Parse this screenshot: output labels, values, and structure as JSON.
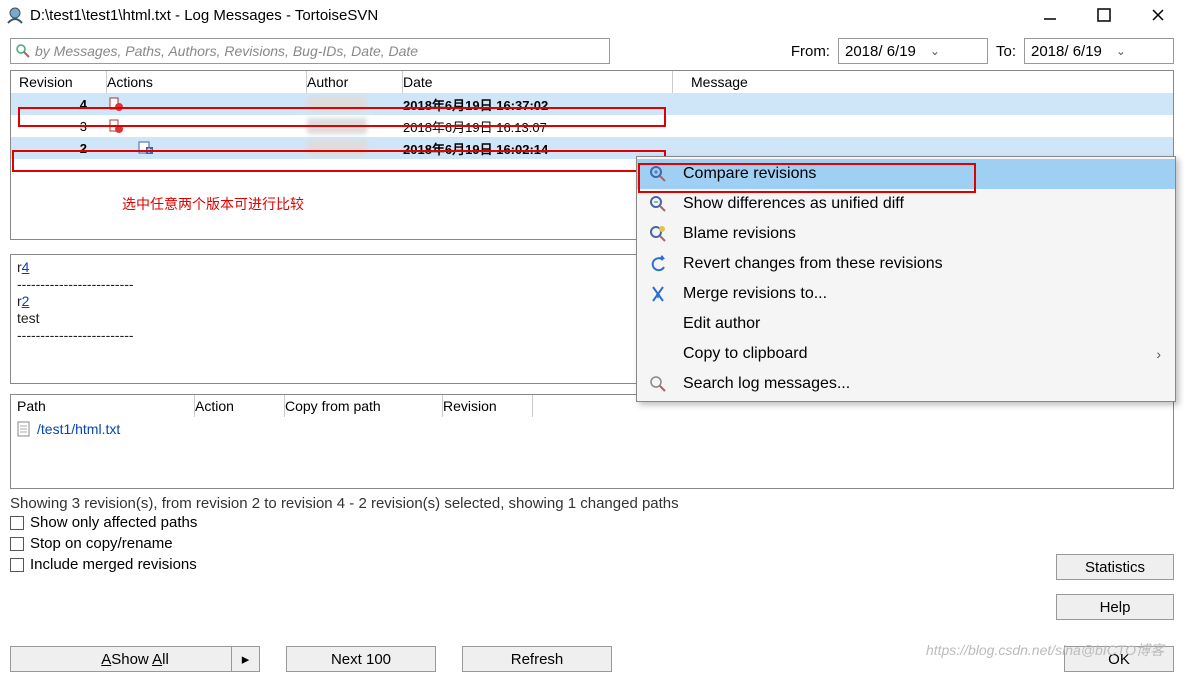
{
  "title": "D:\\test1\\test1\\html.txt - Log Messages - TortoiseSVN",
  "search_placeholder": "by Messages, Paths, Authors, Revisions, Bug-IDs, Date, Date",
  "from_label": "From:",
  "to_label": "To:",
  "from_date": "2018/ 6/19",
  "to_date": "2018/ 6/19",
  "cols": {
    "revision": "Revision",
    "actions": "Actions",
    "author": "Author",
    "date": "Date",
    "message": "Message"
  },
  "rows": [
    {
      "rev": "4",
      "date": "2018年6月19日 16:37:02",
      "selected": true
    },
    {
      "rev": "3",
      "date": "2018年6月19日 16:13:07",
      "selected": false
    },
    {
      "rev": "2",
      "date": "2018年6月19日 16:02:14",
      "selected": true
    }
  ],
  "red_annotation": "选中任意两个版本可进行比较",
  "detail": {
    "r4": "r",
    "r4link": "4",
    "dash": "-------------------------",
    "r2": "r",
    "r2link": "2",
    "msg": "test"
  },
  "pcols": {
    "path": "Path",
    "action": "Action",
    "copy": "Copy from path",
    "rev": "Revision"
  },
  "path_row": "/test1/html.txt",
  "status": "Showing 3 revision(s), from revision 2 to revision 4 - 2 revision(s) selected, showing 1 changed paths",
  "checks": {
    "affected": "Show only affected paths",
    "stop": "Stop on copy/rename",
    "merged": "Include merged revisions"
  },
  "buttons": {
    "statistics": "Statistics",
    "help": "Help",
    "showall": "Show All",
    "next": "Next 100",
    "refresh": "Refresh",
    "ok": "OK"
  },
  "context_menu": [
    {
      "label": "Compare revisions",
      "icon": "mag-in",
      "hl": true
    },
    {
      "label": "Show differences as unified diff",
      "icon": "mag-out"
    },
    {
      "label": "Blame revisions",
      "icon": "blame"
    },
    {
      "label": "Revert changes from these revisions",
      "icon": "revert"
    },
    {
      "label": "Merge revisions to...",
      "icon": "merge"
    },
    {
      "label": "Edit author",
      "icon": ""
    },
    {
      "label": "Copy to clipboard",
      "icon": "",
      "arrow": true
    },
    {
      "label": "Search log messages...",
      "icon": "search"
    }
  ],
  "watermark": "https://blog.csdn.net/sina@bICTO博客"
}
